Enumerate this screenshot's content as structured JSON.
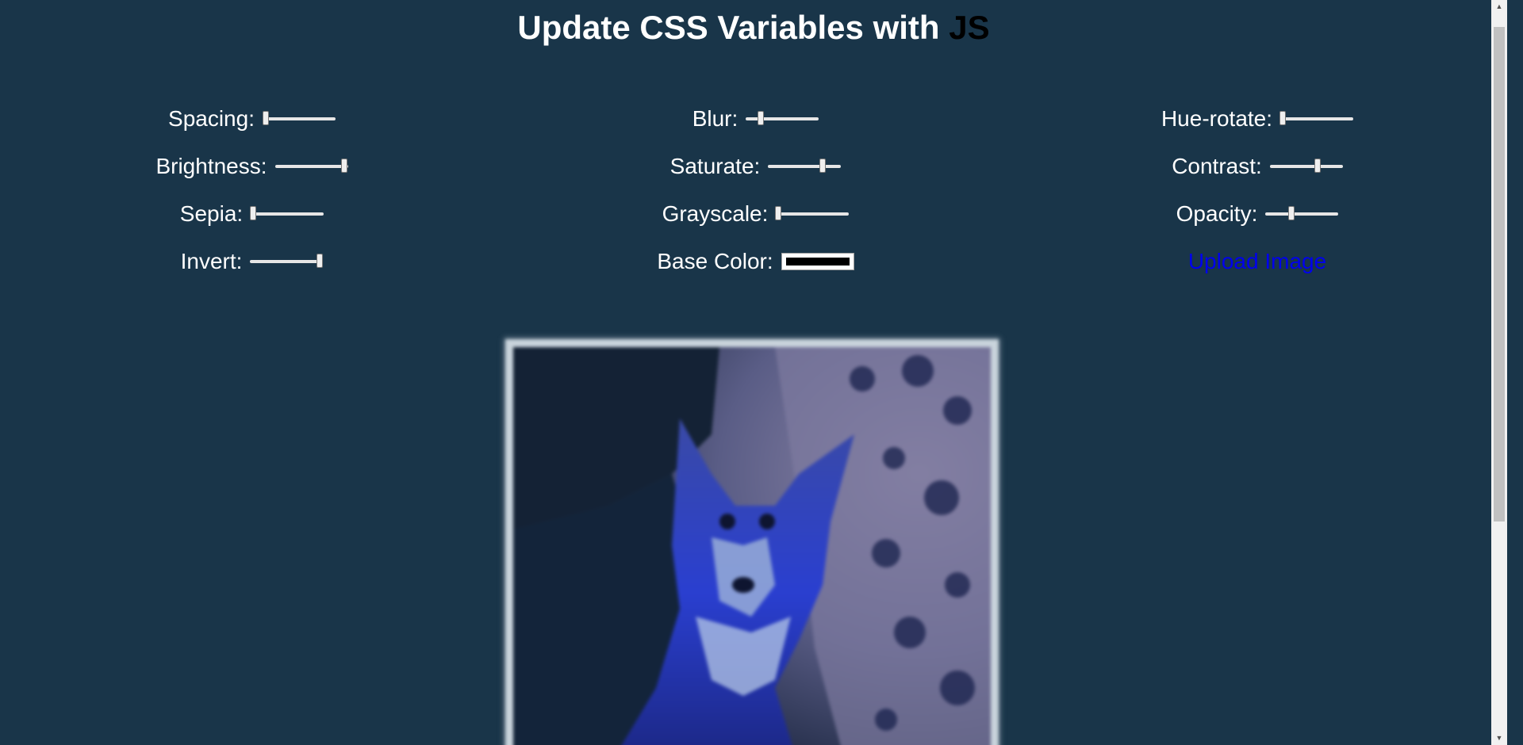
{
  "title": {
    "text": "Update CSS Variables with ",
    "highlight": "JS"
  },
  "controls": [
    {
      "label": "Spacing:",
      "type": "range",
      "value": 0.04
    },
    {
      "label": "Blur:",
      "type": "range",
      "value": 0.2
    },
    {
      "label": "Hue-rotate:",
      "type": "range",
      "value": 0.03
    },
    {
      "label": "Brightness:",
      "type": "range",
      "value": 0.95
    },
    {
      "label": "Saturate:",
      "type": "range",
      "value": 0.75
    },
    {
      "label": "Contrast:",
      "type": "range",
      "value": 0.65
    },
    {
      "label": "Sepia:",
      "type": "range",
      "value": 0.03
    },
    {
      "label": "Grayscale:",
      "type": "range",
      "value": 0.03
    },
    {
      "label": "Opacity:",
      "type": "range",
      "value": 0.35
    },
    {
      "label": "Invert:",
      "type": "range",
      "value": 0.95
    },
    {
      "label": "Base Color:",
      "type": "color",
      "value": "#000000"
    },
    {
      "label": "Upload Image",
      "type": "link",
      "color": "#0000ee"
    }
  ],
  "colors": {
    "background": "#193549",
    "title_highlight": "#000000",
    "link": "#0000ee"
  },
  "image": {
    "subject": "fox-photo-filtered"
  }
}
